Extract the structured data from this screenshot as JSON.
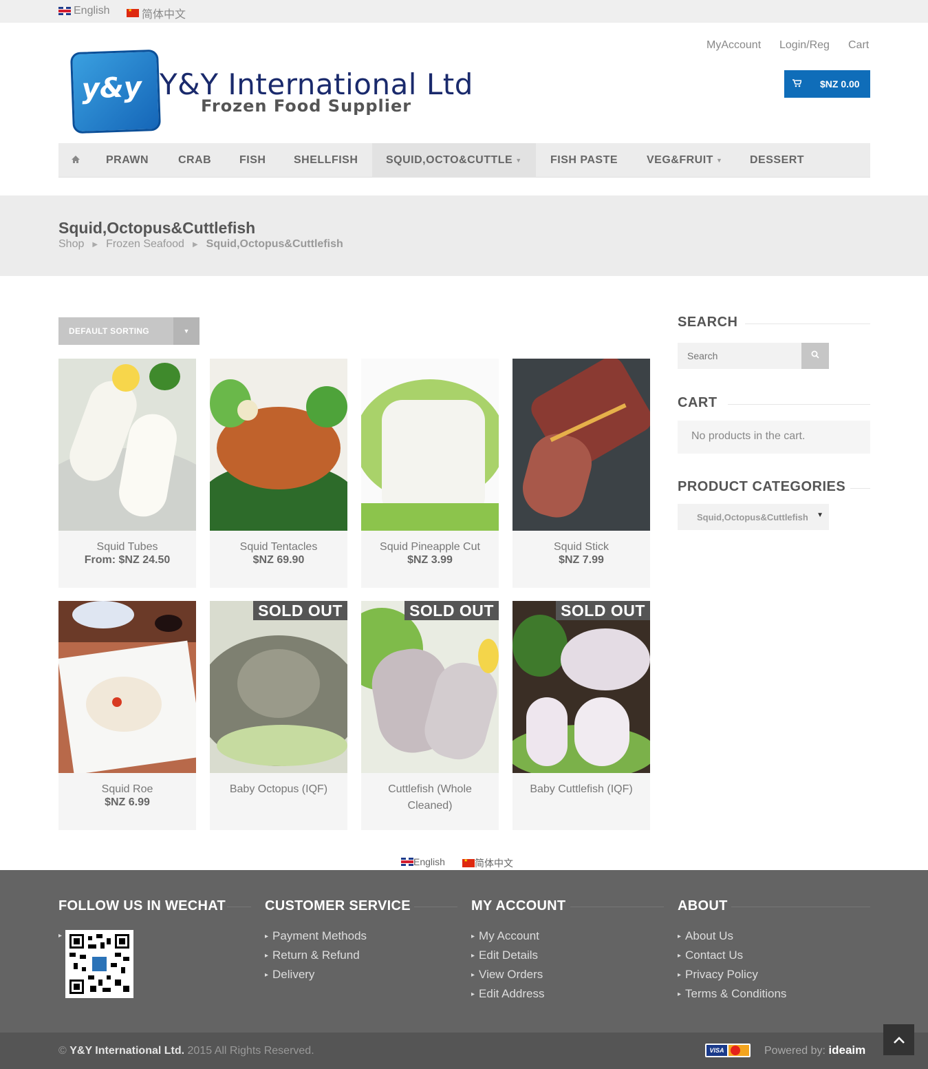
{
  "top_languages": [
    {
      "label": "English"
    },
    {
      "label": "简体中文"
    }
  ],
  "header": {
    "logo_mark": "y&y",
    "logo_title": "Y&Y International Ltd",
    "logo_subtitle": "Frozen Food Supplier",
    "account_links": [
      "MyAccount",
      "Login/Reg",
      "Cart"
    ],
    "cart_total": "$NZ 0.00"
  },
  "nav": {
    "items": [
      "PRAWN",
      "CRAB",
      "FISH",
      "SHELLFISH",
      "SQUID,OCTO&CUTTLE",
      "FISH PASTE",
      "VEG&FRUIT",
      "DESSERT"
    ]
  },
  "page": {
    "title": "Squid,Octopus&Cuttlefish",
    "breadcrumb": [
      "Shop",
      "Frozen Seafood",
      "Squid,Octopus&Cuttlefish"
    ]
  },
  "sorting": {
    "selected": "DEFAULT SORTING"
  },
  "products": [
    {
      "name": "Squid Tubes",
      "price": "From: $NZ 24.50"
    },
    {
      "name": "Squid Tentacles",
      "price": "$NZ 69.90"
    },
    {
      "name": "Squid Pineapple Cut",
      "price": "$NZ 3.99"
    },
    {
      "name": "Squid Stick",
      "price": "$NZ 7.99"
    },
    {
      "name": "Squid Roe",
      "price": "$NZ 6.99"
    },
    {
      "name": "Baby Octopus (IQF)",
      "badge": "SOLD OUT"
    },
    {
      "name": "Cuttlefish (Whole Cleaned)",
      "badge": "SOLD OUT"
    },
    {
      "name": "Baby Cuttlefish (IQF)",
      "badge": "SOLD OUT"
    }
  ],
  "sidebar": {
    "search_heading": "SEARCH",
    "search_placeholder": "Search",
    "cart_heading": "CART",
    "cart_empty": "No products in the cart.",
    "categories_heading": "PRODUCT CATEGORIES",
    "category_selected": "Squid,Octopus&Cuttlefish"
  },
  "footer_languages": [
    {
      "label": "English"
    },
    {
      "label": "简体中文"
    }
  ],
  "footer": {
    "wechat_heading": "FOLLOW US IN WECHAT",
    "customer_service": {
      "heading": "CUSTOMER SERVICE",
      "links": [
        "Payment Methods",
        "Return & Refund",
        "Delivery"
      ]
    },
    "my_account": {
      "heading": "MY ACCOUNT",
      "links": [
        "My Account",
        "Edit Details",
        "View Orders",
        "Edit Address"
      ]
    },
    "about": {
      "heading": "ABOUT",
      "links": [
        "About Us",
        "Contact Us",
        "Privacy Policy",
        "Terms & Conditions"
      ]
    },
    "copyright_company": "Y&Y International Ltd.",
    "copyright_prefix": "©",
    "copyright_suffix": "2015 All Rights Reserved.",
    "card_visa": "VISA",
    "powered_label": "Powered by:",
    "powered_brand": "ideaim"
  },
  "colors": {
    "accent": "#0f6db9",
    "footer": "#646464",
    "bottombar": "#555555"
  },
  "icons": [
    "home-icon",
    "cart-icon",
    "search-icon",
    "caret-down-icon",
    "arrow-up-icon",
    "qr-code-icon"
  ]
}
